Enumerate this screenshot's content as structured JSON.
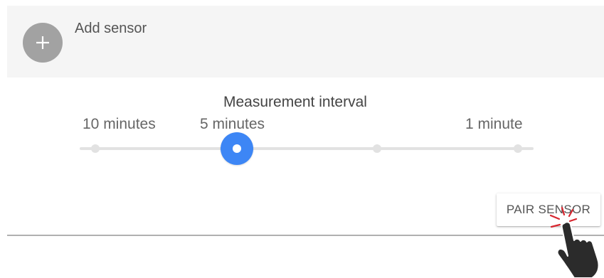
{
  "add_sensor": {
    "label": "Add sensor",
    "icon": "plus-icon"
  },
  "measurement_interval": {
    "title": "Measurement interval",
    "tick_labels": [
      "10 minutes",
      "5 minutes",
      "1 minute"
    ],
    "stop_count": 4,
    "selected_value": "5 minutes",
    "accent_color": "#3d86f5"
  },
  "actions": {
    "pair_sensor_label": "PAIR SENSOR"
  },
  "overlay": {
    "icon": "pointing-hand-cursor-icon",
    "click_burst_color": "#d7262f"
  }
}
